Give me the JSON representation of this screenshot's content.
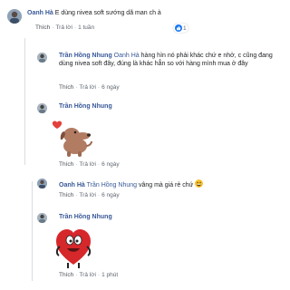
{
  "comments": [
    {
      "author": "Oanh Hà",
      "text": "E dùng nivea soft sướng dã man ch à",
      "actions": {
        "like": "Thích",
        "reply": "Trả lời",
        "time": "1 tuần"
      },
      "reaction_count": "1"
    },
    {
      "author": "Trần Hồng Nhung",
      "mention": "Oanh Hà",
      "text": "hàng hìn nó phải khác chứ e nhở, c cũng đang dùng nivea soft đây, đúng là khác hẳn so với hàng mình mua ở đây",
      "actions": {
        "like": "Thích",
        "reply": "Trả lời",
        "time": "6 ngày"
      }
    },
    {
      "author": "Trần Hồng Nhung",
      "sticker": "dog-with-heart-sticker",
      "actions": {
        "like": "Thích",
        "reply": "Trả lời",
        "time": "6 ngày"
      }
    },
    {
      "author": "Oanh Hà",
      "mention": "Trần Hồng Nhung",
      "text": "vâng mà giá rẻ chứ",
      "emoji": "grinning-face-emoji",
      "actions": {
        "like": "Thích",
        "reply": "Trả lời",
        "time": "6 ngày"
      }
    },
    {
      "author": "Trần Hồng Nhung",
      "sticker": "heart-character-sticker",
      "actions": {
        "like": "Thích",
        "reply": "Trả lời",
        "time": "1 phút"
      }
    }
  ],
  "colors": {
    "name": "#385898",
    "like": "#1877f2",
    "meta": "#606770"
  }
}
